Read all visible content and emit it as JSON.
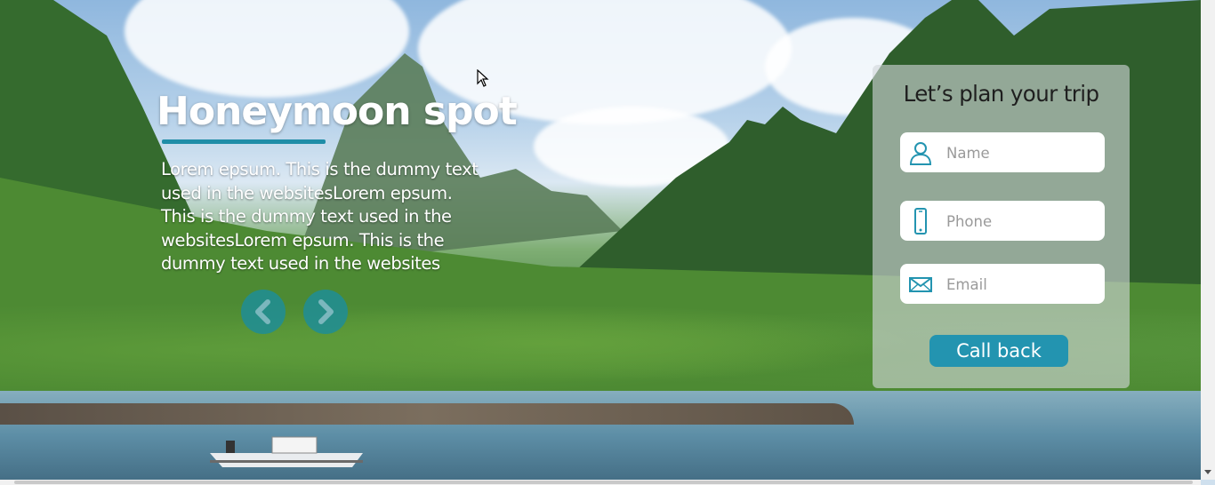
{
  "hero": {
    "title": "Honeymoon spot",
    "description": "Lorem epsum. This is the  dummy text used in the websitesLorem epsum. This is the  dummy text used in the websitesLorem epsum. This is the  dummy text used in the websites",
    "prev_icon": "chevron-left-icon",
    "next_icon": "chevron-right-icon"
  },
  "form": {
    "title": "Let’s plan your trip",
    "name": {
      "placeholder": "Name",
      "icon": "user-icon"
    },
    "phone": {
      "placeholder": "Phone",
      "icon": "mobile-phone-icon"
    },
    "email": {
      "placeholder": "Email",
      "icon": "envelope-icon"
    },
    "submit_label": "Call back"
  },
  "colors": {
    "accent": "#2394b0",
    "panel": "#d2d6da",
    "title_text": "#ffffff"
  }
}
